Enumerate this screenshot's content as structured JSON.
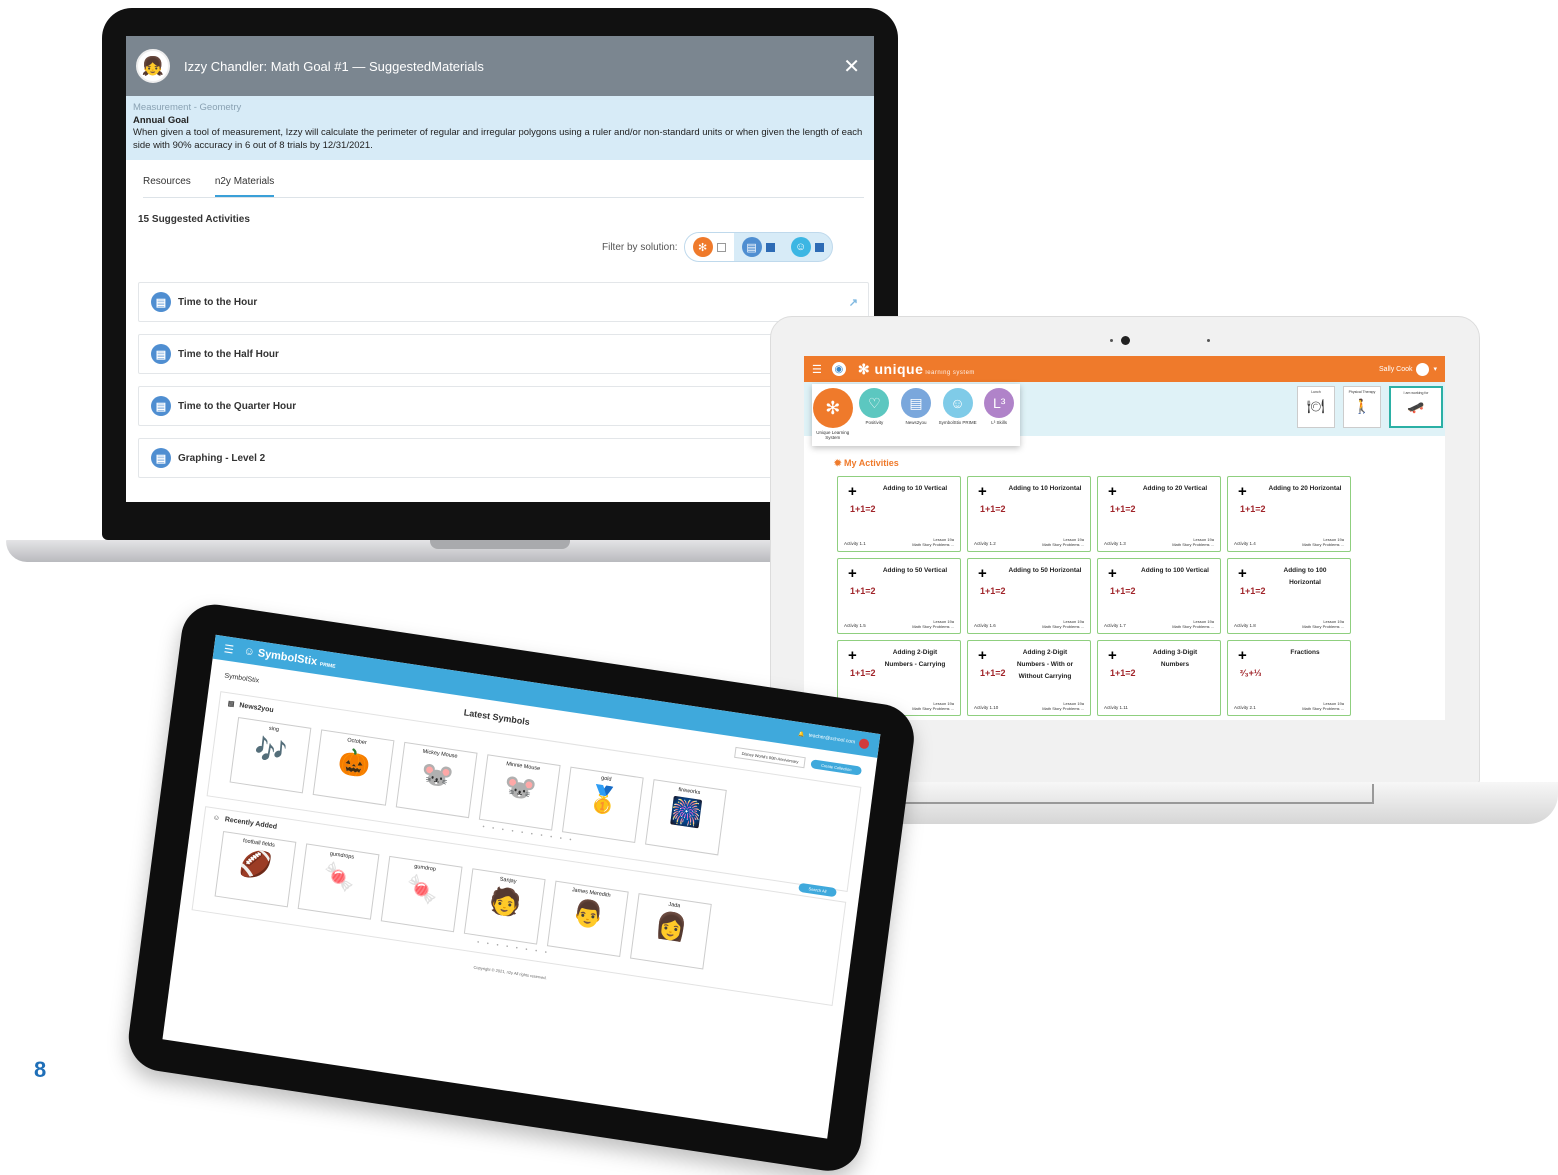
{
  "macbook": {
    "header_title": "Izzy Chandler: Math Goal #1 — SuggestedMaterials",
    "close_icon": "close-icon",
    "goal_category": "Measurement - Geometry",
    "goal_label": "Annual Goal",
    "goal_text": "When given a tool of measurement, Izzy will calculate the perimeter of regular and irregular polygons using a ruler and/or non-standard units or when given the length of each side with 90% accuracy in 6 out of 8 trials by 12/31/2021.",
    "tabs": [
      {
        "label": "Resources"
      },
      {
        "label": "n2y Materials"
      }
    ],
    "active_tab": "n2y Materials",
    "suggested_count": "15 Suggested Activities",
    "filter_label": "Filter by solution:",
    "activities": [
      {
        "label": "Time to the Hour"
      },
      {
        "label": "Time to the Half Hour"
      },
      {
        "label": "Time to the Quarter Hour"
      },
      {
        "label": "Graphing - Level 2"
      }
    ]
  },
  "uls": {
    "logo": "unique",
    "logo_sub": "learning system",
    "user": "Sally Cook",
    "apps": [
      {
        "label": "Unique Learning System",
        "color": "#ef7a2b"
      },
      {
        "label": "Positivity",
        "color": "#5cc7c0"
      },
      {
        "label": "News2you",
        "color": "#7aa7dc"
      },
      {
        "label": "SymbolStix PRIME",
        "color": "#7fcbe8"
      },
      {
        "label": "L³ Skills",
        "color": "#b083c9"
      }
    ],
    "schedule_cards": [
      {
        "label": "Lunch"
      },
      {
        "label": "Physical Therapy"
      },
      {
        "label": "I am working for"
      }
    ],
    "my_activities": "My Activities",
    "cards": [
      {
        "title": "Adding to 10 Vertical",
        "activity": "Activity 1.1",
        "lesson": "Lesson 19a",
        "sub": "Math Story Problems ..."
      },
      {
        "title": "Adding to 10 Horizontal",
        "activity": "Activity 1.2",
        "lesson": "Lesson 19a",
        "sub": "Math Story Problems ..."
      },
      {
        "title": "Adding to 20 Vertical",
        "activity": "Activity 1.3",
        "lesson": "Lesson 19a",
        "sub": "Math Story Problems ..."
      },
      {
        "title": "Adding to 20 Horizontal",
        "activity": "Activity 1.4",
        "lesson": "Lesson 19a",
        "sub": "Math Story Problems ..."
      },
      {
        "title": "Adding to 50 Vertical",
        "activity": "Activity 1.5",
        "lesson": "Lesson 19a",
        "sub": "Math Story Problems ..."
      },
      {
        "title": "Adding to 50 Horizontal",
        "activity": "Activity 1.6",
        "lesson": "Lesson 19a",
        "sub": "Math Story Problems ..."
      },
      {
        "title": "Adding to 100 Vertical",
        "activity": "Activity 1.7",
        "lesson": "Lesson 19a",
        "sub": "Math Story Problems ..."
      },
      {
        "title": "Adding to 100 Horizontal",
        "activity": "Activity 1.8",
        "lesson": "Lesson 19a",
        "sub": "Math Story Problems ..."
      },
      {
        "title": "Adding 2-Digit Numbers - Carrying",
        "activity": "Activity 1.9",
        "lesson": "Lesson 19a",
        "sub": "Math Story Problems ..."
      },
      {
        "title": "Adding 2-Digit Numbers - With or Without Carrying",
        "activity": "Activity 1.10",
        "lesson": "Lesson 19a",
        "sub": "Math Story Problems ..."
      },
      {
        "title": "Adding 3-Digit Numbers",
        "activity": "Activity 1.11",
        "lesson": "",
        "sub": ""
      },
      {
        "title": "Fractions",
        "activity": "Activity 2.1",
        "lesson": "Lesson 19a",
        "sub": "Math Story Problems ..."
      }
    ],
    "equation": "1+1=2",
    "fraction_equation": "²⁄₃+⅓"
  },
  "symbolstix": {
    "logo": "SymbolStix",
    "logo_sub": "PRIME",
    "account": "teacher@school.com",
    "left_logo": "SymbolStix",
    "heading": "Latest Symbols",
    "dropdown": "Disney World's 50th Anniversary",
    "create_button": "Create Collection",
    "section1": {
      "title": "News2you",
      "items": [
        {
          "label": "sing",
          "icon": "🎶"
        },
        {
          "label": "October",
          "icon": "🎃"
        },
        {
          "label": "Mickey Mouse",
          "icon": "🐭"
        },
        {
          "label": "Minnie Mouse",
          "icon": "🐭"
        },
        {
          "label": "gold",
          "icon": "🥇"
        },
        {
          "label": "fireworks",
          "icon": "🎆"
        }
      ]
    },
    "see_all": "Search All",
    "section2": {
      "title": "Recently Added",
      "items": [
        {
          "label": "football fields",
          "icon": "🏈"
        },
        {
          "label": "gumdrops",
          "icon": "🍬"
        },
        {
          "label": "gumdrop",
          "icon": "🍬"
        },
        {
          "label": "Sanjay",
          "icon": "🧑"
        },
        {
          "label": "James Meredith",
          "icon": "👨"
        },
        {
          "label": "Jada",
          "icon": "👩"
        }
      ]
    },
    "footer": "Copyright © 2021, n2y All rights reserved."
  },
  "page_number": "8"
}
